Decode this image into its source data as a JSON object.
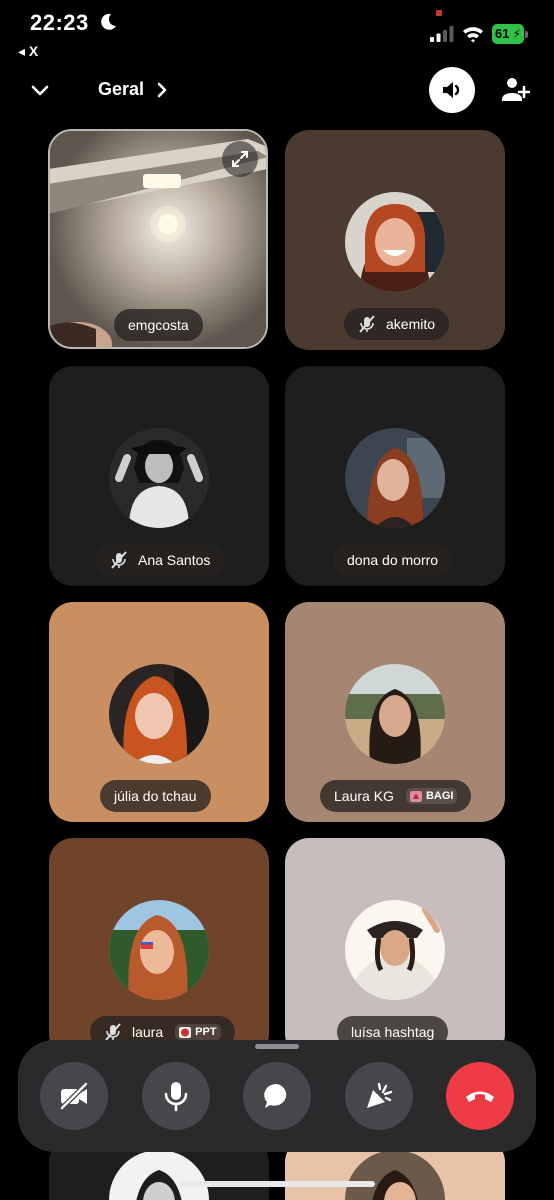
{
  "status_bar": {
    "time": "22:23",
    "back_app": "◂ X",
    "battery": "61"
  },
  "header": {
    "channel_name": "Geral"
  },
  "participants": [
    {
      "name": "emgcosta",
      "video": true,
      "muted": false
    },
    {
      "name": "akemito",
      "muted": true,
      "bg": "#4a3a2f"
    },
    {
      "name": "Ana Santos",
      "muted": true,
      "bg": "#1e1e1e"
    },
    {
      "name": "dona do morro",
      "muted": false,
      "bg": "#1e1e1e"
    },
    {
      "name": "júlia do tchau",
      "muted": false,
      "bg": "#c98f60"
    },
    {
      "name": "Laura KG",
      "muted": false,
      "tag": "BAGI",
      "bg": "#a68673"
    },
    {
      "name": "laura",
      "muted": true,
      "tag": "PPT",
      "bg": "#70442b"
    },
    {
      "name": "luísa hashtag",
      "muted": false,
      "bg": "#c7bdbd"
    }
  ],
  "controls": {
    "items": [
      "camera-off",
      "microphone",
      "chat",
      "activities",
      "hang-up"
    ]
  },
  "colors": {
    "hangup": "#ee3a44",
    "control_bg": "#47474b",
    "bar_bg": "#2a2a2c"
  }
}
